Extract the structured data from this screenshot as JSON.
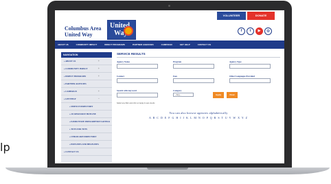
{
  "edge_texts": [
    "",
    "lp"
  ],
  "header": {
    "brand": [
      "Columbus Area",
      "United Way"
    ],
    "logo_text": [
      "United",
      "Way"
    ],
    "volunteer_label": "VOLUNTEER",
    "donate_label": "DONATE",
    "social_icons": [
      "facebook-icon",
      "twitter-icon",
      "youtube-icon",
      "instagram-icon"
    ]
  },
  "nav": {
    "items": [
      "ABOUT US",
      "COMMUNITY IMPACT",
      "DIRECT PROGRAMS",
      "PARTNER AGENCIES",
      "CAMPAIGN",
      "GET HELP",
      "CONTACT US"
    ]
  },
  "sidebar": {
    "title": "NAVIGATION",
    "items": [
      {
        "label": "» ABOUT US",
        "expand": "+"
      },
      {
        "label": "» COMMUNITY IMPACT",
        "expand": "+"
      },
      {
        "label": "» DIRECT PROGRAMS",
        "expand": "+"
      },
      {
        "label": "» PARTNER AGENCIES",
        "expand": ""
      },
      {
        "label": "» CAMPAIGN",
        "expand": "+"
      },
      {
        "label": "» GET HELP",
        "expand": "−"
      },
      {
        "label": "» SERVICE DIRECTORY",
        "expand": ""
      },
      {
        "label": "» 211 RESOURCE HOTLINE",
        "expand": ""
      },
      {
        "label": "» FAMILYWIZE PRESCRIPTION SAVINGS",
        "expand": ""
      },
      {
        "label": "» TOYS FOR TOTS",
        "expand": ""
      },
      {
        "label": "» CHILDCARE DIRECTORY",
        "expand": ""
      },
      {
        "label": "» HOTLINES AND HELPLINES",
        "expand": ""
      },
      {
        "label": "» CONTACT US",
        "expand": ""
      }
    ]
  },
  "main": {
    "title": "SERVICE RESULTS",
    "fields": {
      "agency_name": "Agency Name",
      "program": "Program",
      "agency_type": "Agency Type",
      "contact": "Contact",
      "fees": "Fees",
      "other_languages": "Other Languages Provided",
      "search_keyword": "Search with keyword",
      "category": "Category"
    },
    "category_value": "- Any -",
    "apply_label": "Apply",
    "clear_label": "Clear",
    "hint": "Select any filter and click on Apply to see results",
    "browse_text": "You can also browse agencies alphabetically",
    "letters": "A B C D E F G H I J K L M N O P Q R S T U V W X Y Z"
  }
}
